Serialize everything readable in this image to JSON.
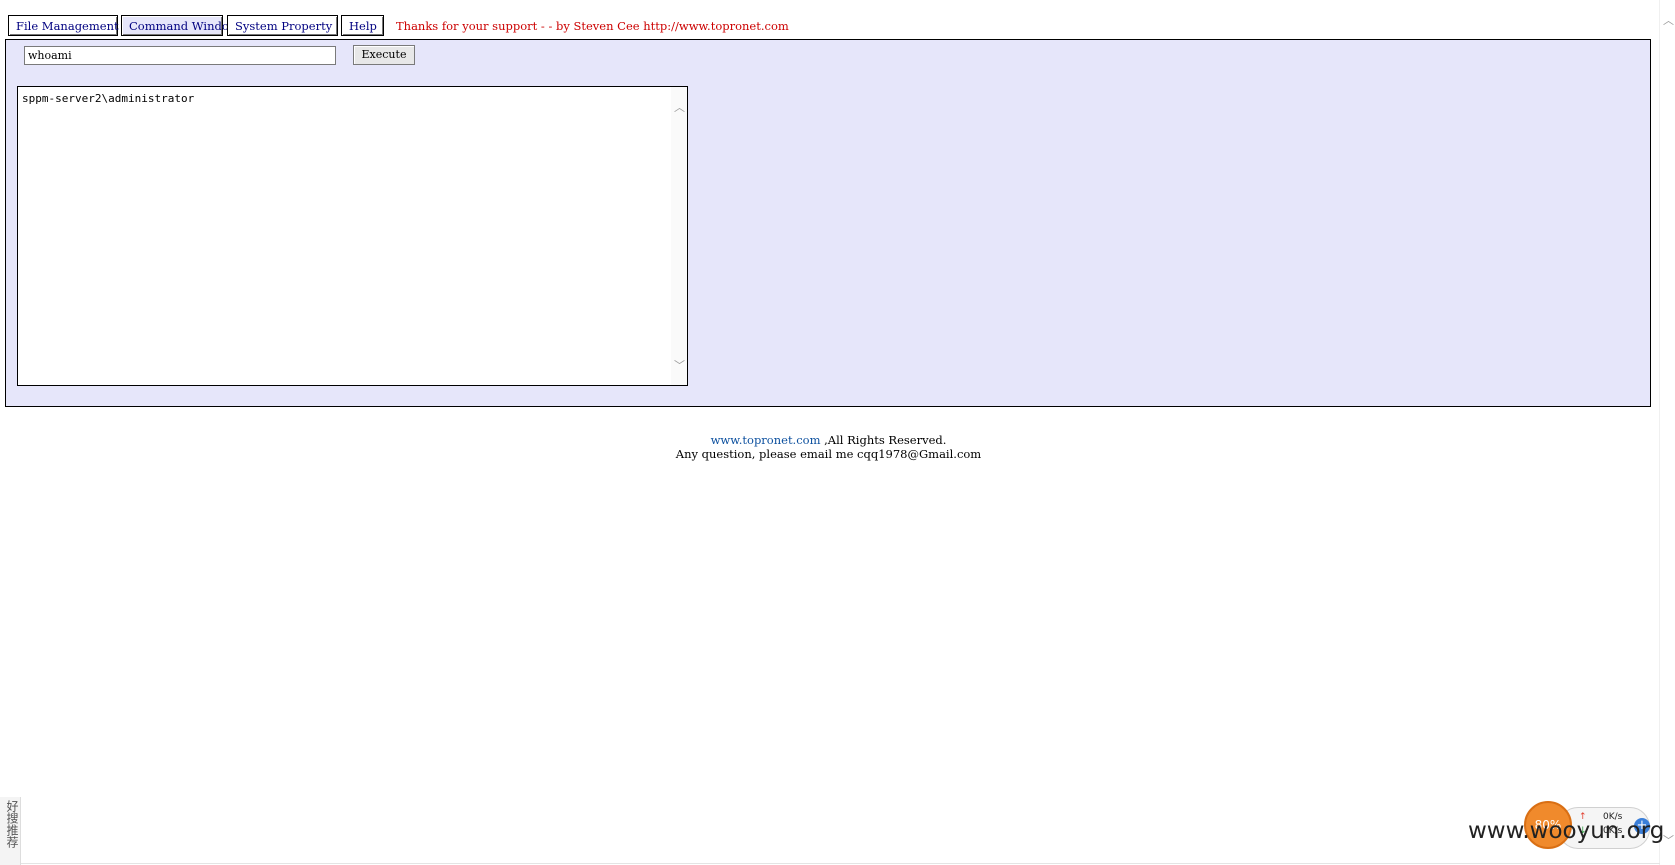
{
  "tabs": [
    {
      "label": "File Management",
      "active": false
    },
    {
      "label": "Command Window",
      "active": true
    },
    {
      "label": "System Property",
      "active": false
    },
    {
      "label": "Help",
      "active": false
    }
  ],
  "thanks_text": "Thanks for your support - - by Steven Cee http://www.topronet.com",
  "command": {
    "input_value": "whoami",
    "execute_label": "Execute",
    "output": "sppm-server2\\administrator"
  },
  "footer": {
    "link": "www.topronet.com",
    "rights": " ,All Rights Reserved.",
    "contact": "Any question, please email me cqq1978@Gmail.com"
  },
  "side_strip": "好搜推荐",
  "widget": {
    "percent": "80%",
    "up_speed": "0K/s",
    "down_speed": "0K/s"
  },
  "watermark": "www.wooyun.org",
  "colors": {
    "panel_bg": "#e6e6fa",
    "tab_text": "#000080",
    "thanks_text": "#cc0000",
    "link": "#0b4f9e"
  }
}
